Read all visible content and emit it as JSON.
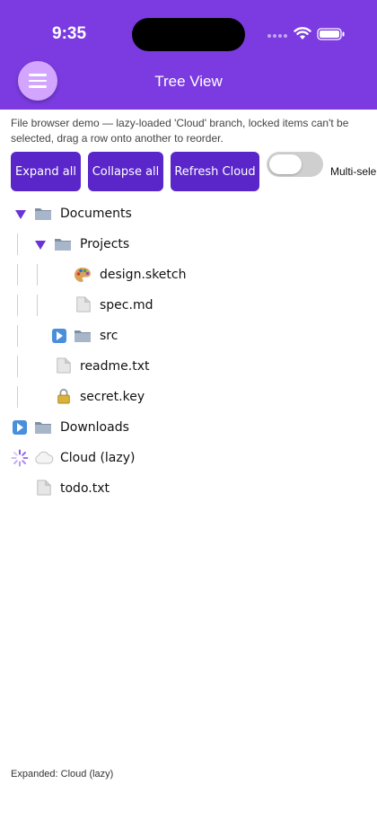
{
  "status_bar": {
    "time": "9:35"
  },
  "app_bar": {
    "title": "Tree View"
  },
  "description": "File browser demo — lazy-loaded 'Cloud' branch, locked items can't be selected, drag a row onto another to reorder.",
  "toolbar": {
    "expand_all": "Expand all",
    "collapse_all": "Collapse all",
    "refresh_cloud": "Refresh Cloud",
    "multi_select_label": "Multi-sele",
    "multi_select_on": false
  },
  "tree": [
    {
      "label": "Documents",
      "icon": "folder-icon",
      "state": "expanded",
      "depth": 0
    },
    {
      "label": "Projects",
      "icon": "folder-icon",
      "state": "expanded",
      "depth": 1
    },
    {
      "label": "design.sketch",
      "icon": "palette-icon",
      "state": "leaf",
      "depth": 2
    },
    {
      "label": "spec.md",
      "icon": "file-icon",
      "state": "leaf",
      "depth": 2
    },
    {
      "label": "src",
      "icon": "folder-icon",
      "state": "collapsed",
      "depth": 1
    },
    {
      "label": "readme.txt",
      "icon": "file-icon",
      "state": "leaf",
      "depth": 1
    },
    {
      "label": "secret.key",
      "icon": "lock-icon",
      "state": "locked",
      "depth": 1
    },
    {
      "label": "Downloads",
      "icon": "folder-icon",
      "state": "collapsed",
      "depth": 0
    },
    {
      "label": "Cloud (lazy)",
      "icon": "cloud-icon",
      "state": "loading",
      "depth": 0
    },
    {
      "label": "todo.txt",
      "icon": "file-icon",
      "state": "leaf",
      "depth": 0
    }
  ],
  "footer": {
    "status": "Expanded: Cloud (lazy)"
  },
  "colors": {
    "header": "#7b3be0",
    "button": "#5a26c9",
    "menu_button": "#d3a5ff",
    "arrow": "#6a33d6"
  }
}
